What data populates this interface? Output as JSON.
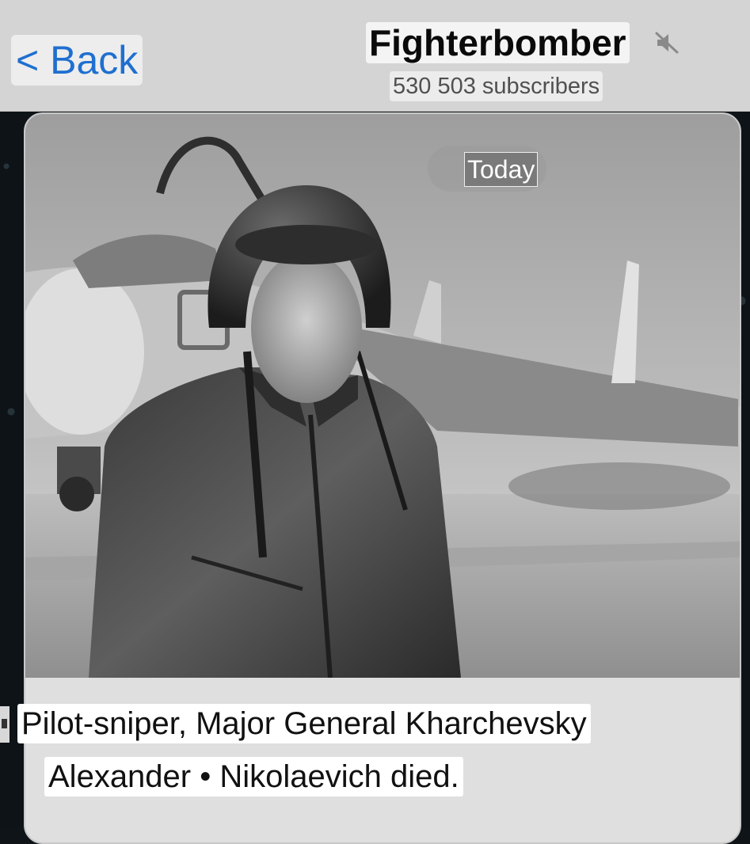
{
  "header": {
    "back_label": "< Back",
    "channel_title": "Fighterbomber",
    "subscribers": "530 503 subscribers",
    "muted_icon": "speaker-muted-icon"
  },
  "message": {
    "date_label": "Today",
    "photo_icon": "photo-pilot-jet",
    "caption_line_1": "Pilot-sniper, Major General Kharchevsky",
    "caption_line_2": "Alexander • Nikolaevich died."
  },
  "colors": {
    "link_blue": "#1f6fd0",
    "header_bg": "#d4d4d4",
    "chat_bg": "#0d1317"
  }
}
